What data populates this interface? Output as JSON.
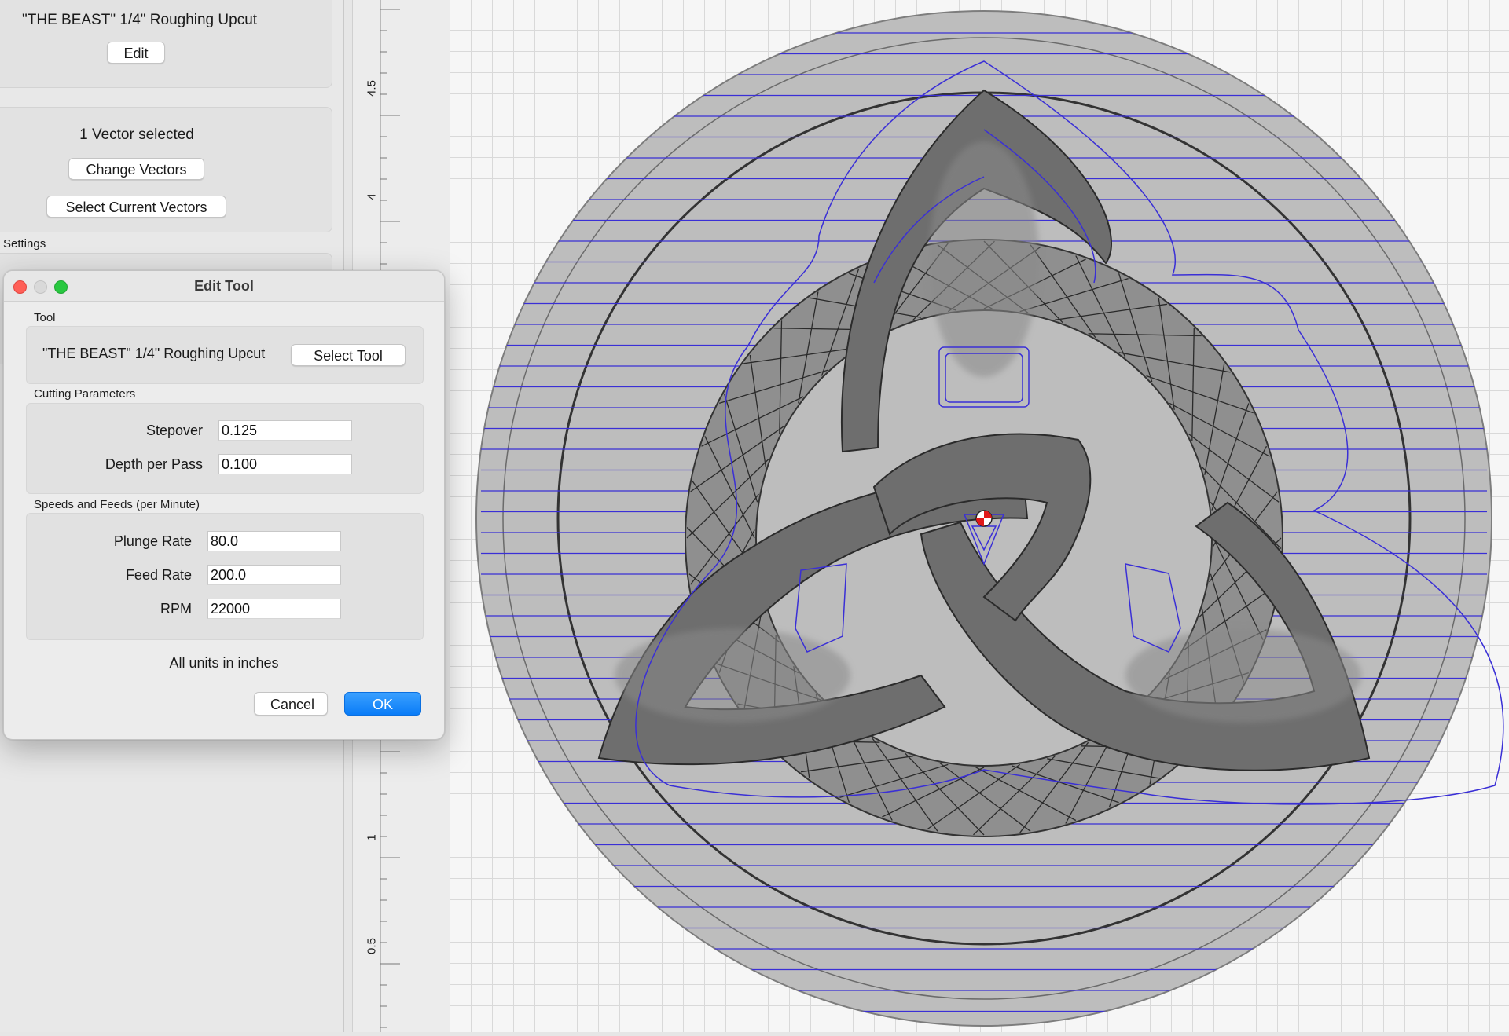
{
  "sidebar": {
    "tool_name": "\"THE BEAST\" 1/4\" Roughing Upcut",
    "edit_label": "Edit",
    "vector_status": "1 Vector selected",
    "change_vectors_label": "Change Vectors",
    "select_current_vectors_label": "Select Current Vectors",
    "settings_heading": "Settings"
  },
  "ruler": {
    "ticks": [
      "4.5",
      "4",
      "1",
      "0.5"
    ]
  },
  "dialog": {
    "title": "Edit Tool",
    "tool_section": "Tool",
    "tool_name": "\"THE BEAST\" 1/4\" Roughing Upcut",
    "select_tool_label": "Select Tool",
    "cutting_section": "Cutting Parameters",
    "stepover_label": "Stepover",
    "stepover_value": "0.125",
    "depth_label": "Depth per Pass",
    "depth_value": "0.100",
    "speeds_section": "Speeds and Feeds (per Minute)",
    "plunge_label": "Plunge Rate",
    "plunge_value": "80.0",
    "feed_label": "Feed Rate",
    "feed_value": "200.0",
    "rpm_label": "RPM",
    "rpm_value": "22000",
    "units_note": "All units in inches",
    "cancel_label": "Cancel",
    "ok_label": "OK"
  },
  "colors": {
    "toolpath": "#3a2fd6",
    "stock": "#bdbdbd",
    "knot": "#7a7a7a",
    "accent": "#0a7cf7",
    "close": "#ff5f57",
    "zoom": "#28c840"
  }
}
